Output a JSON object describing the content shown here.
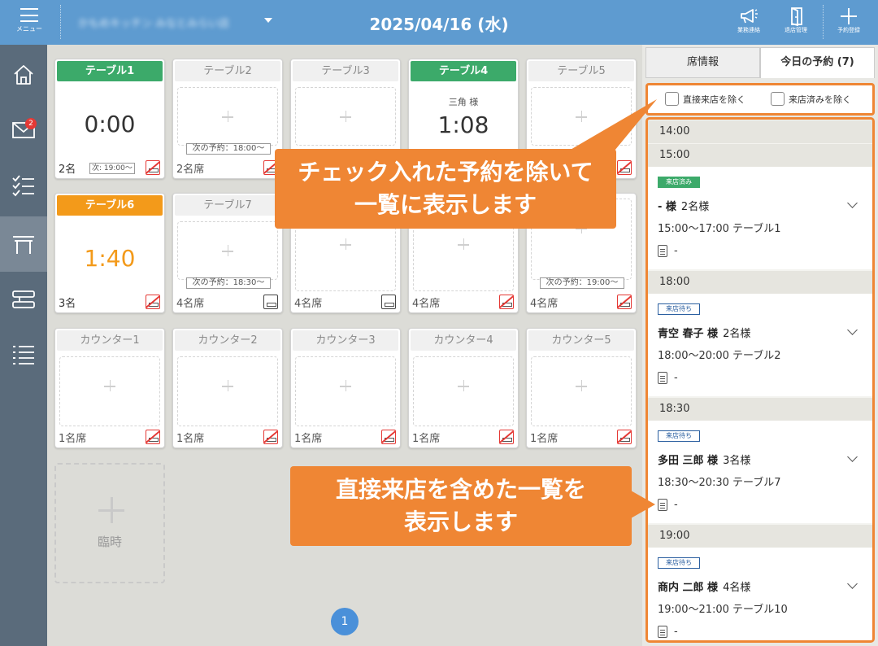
{
  "header": {
    "menu_label": "メニュー",
    "store_name": "かもめキッチン みなとみらい店",
    "date": "2025/04/16 (水)",
    "buttons": [
      {
        "label": "業務連絡",
        "icon": "megaphone-icon"
      },
      {
        "label": "退店管理",
        "icon": "exit-door-icon"
      },
      {
        "label": "予約登録",
        "icon": "plus-icon"
      }
    ]
  },
  "sidebar": {
    "items": [
      {
        "icon": "home-icon"
      },
      {
        "icon": "mail-icon",
        "badge": "2"
      },
      {
        "icon": "checklist-icon"
      },
      {
        "icon": "table-icon",
        "active": true
      },
      {
        "icon": "layout-icon"
      },
      {
        "icon": "list-icon"
      }
    ]
  },
  "tables": [
    {
      "name": "テーブル1",
      "state": "occupied",
      "time": "0:00",
      "seats": "2名",
      "next": "次: 19:00～"
    },
    {
      "name": "テーブル2",
      "state": "empty",
      "seats": "2名席",
      "next": "次の予約：18:00～"
    },
    {
      "name": "テーブル3",
      "state": "empty"
    },
    {
      "name": "テーブル4",
      "state": "occupied",
      "guest": "三角 様",
      "time": "1:08"
    },
    {
      "name": "テーブル5",
      "state": "empty"
    },
    {
      "name": "テーブル6",
      "state": "over",
      "time": "1:40",
      "seats": "3名"
    },
    {
      "name": "テーブル7",
      "state": "empty",
      "seats": "4名席",
      "next": "次の予約：18:30～"
    },
    {
      "name": "",
      "state": "empty",
      "seats": "4名席"
    },
    {
      "name": "",
      "state": "empty",
      "seats": "4名席"
    },
    {
      "name": "",
      "state": "empty",
      "seats": "4名席",
      "next": "次の予約：19:00～"
    }
  ],
  "counters": [
    {
      "name": "カウンター1",
      "seats": "1名席"
    },
    {
      "name": "カウンター2",
      "seats": "1名席"
    },
    {
      "name": "カウンター3",
      "seats": "1名席"
    },
    {
      "name": "カウンター4",
      "seats": "1名席"
    },
    {
      "name": "カウンター5",
      "seats": "1名席"
    }
  ],
  "temp_card": {
    "label": "臨時"
  },
  "page_number": "1",
  "right_panel": {
    "tabs": [
      "席情報",
      "今日の予約 (7)"
    ],
    "filters": [
      "直接来店を除く",
      "来店済みを除く"
    ],
    "slots": [
      {
        "time": "14:00"
      },
      {
        "time": "15:00",
        "reservation": {
          "status": "来店済み",
          "status_type": "done",
          "name": "- 様",
          "count": "2名様",
          "time": "15:00～17:00 テーブル1",
          "memo": "-"
        }
      },
      {
        "time": "18:00",
        "reservation": {
          "status": "来店待ち",
          "status_type": "wait",
          "name": "青空 春子 様",
          "count": "2名様",
          "time": "18:00～20:00 テーブル2",
          "memo": "-"
        }
      },
      {
        "time": "18:30",
        "reservation": {
          "status": "来店待ち",
          "status_type": "wait",
          "name": "多田 三郎 様",
          "count": "3名様",
          "time": "18:30～20:30 テーブル7",
          "memo": "-"
        }
      },
      {
        "time": "19:00",
        "reservation": {
          "status": "来店待ち",
          "status_type": "wait",
          "name": "商内 二郎 様",
          "count": "4名様",
          "time": "19:00～21:00 テーブル10",
          "memo": "-"
        }
      }
    ]
  },
  "callouts": {
    "top": [
      "チェック入れた予約を除いて",
      "一覧に表示します"
    ],
    "bottom": [
      "直接来店を含めた一覧を",
      "表示します"
    ]
  },
  "colors": {
    "header": "#5e9bd0",
    "accent_orange": "#ef8634",
    "occupied_green": "#3caa6a",
    "over_orange": "#f39a1a"
  }
}
